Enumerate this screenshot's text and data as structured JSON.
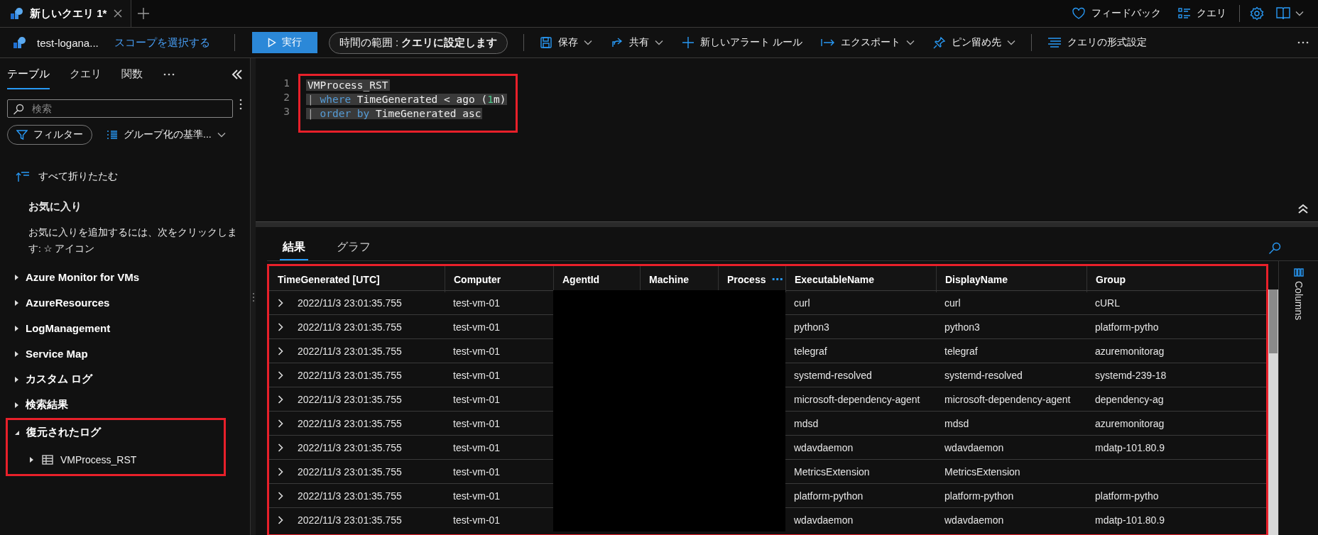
{
  "tabs": [
    {
      "label": "新しいクエリ 1*",
      "selected": true
    }
  ],
  "top_actions": [
    {
      "label": "フィードバック",
      "kind": "heart"
    },
    {
      "label": "クエリ",
      "kind": "list"
    }
  ],
  "toolbar": {
    "workspace": "test-logana...",
    "scope_link": "スコープを選択する",
    "run": "実行",
    "time_range": "時間の範囲 : **クエリに設定します**",
    "actions": [
      {
        "label": "保存",
        "kind": "save",
        "dropdown": true
      },
      {
        "label": "共有",
        "kind": "share",
        "dropdown": true
      },
      {
        "label": "新しいアラート ルール",
        "kind": "plus",
        "dropdown": false
      },
      {
        "label": "エクスポート",
        "kind": "export",
        "dropdown": true
      },
      {
        "label": "ピン留め先",
        "kind": "pin",
        "dropdown": true
      },
      {
        "label": "クエリの形式設定",
        "kind": "format",
        "dropdown": false
      }
    ]
  },
  "sidebar": {
    "tabs": [
      {
        "label": "テーブル",
        "selected": true
      },
      {
        "label": "クエリ",
        "selected": false
      },
      {
        "label": "関数",
        "selected": false
      }
    ],
    "search": {
      "placeholder": "検索"
    },
    "filter": "フィルター",
    "group_by": "グループ化の基準...",
    "collapse_all": "すべて折りたたむ",
    "favorites": {
      "title": "お気に入り",
      "hint": "お気に入りを追加するには、次をクリックします:  ☆ アイコン"
    },
    "tree": [
      {
        "label": "Azure Monitor for VMs",
        "expanded": false,
        "annotated": false
      },
      {
        "label": "AzureResources",
        "expanded": false,
        "annotated": false
      },
      {
        "label": "LogManagement",
        "expanded": false,
        "annotated": false
      },
      {
        "label": "Service Map",
        "expanded": false,
        "annotated": false
      },
      {
        "label": "カスタム ログ",
        "expanded": false,
        "annotated": false
      },
      {
        "label": "検索結果",
        "expanded": false,
        "annotated": false
      },
      {
        "label": "復元されたログ",
        "expanded": true,
        "annotated": true,
        "children": [
          {
            "label": "VMProcess_RST",
            "expanded": false
          }
        ]
      }
    ]
  },
  "editor": {
    "annotated": true,
    "lines": [
      {
        "number": "1",
        "selected": true,
        "tokens": [
          {
            "text": "VMProcess_RST",
            "kind": "plain"
          }
        ]
      },
      {
        "number": "2",
        "selected": true,
        "tokens": [
          {
            "text": "| ",
            "kind": "pipe"
          },
          {
            "text": "where",
            "kind": "keyword"
          },
          {
            "text": " TimeGenerated < ago (",
            "kind": "plain"
          },
          {
            "text": "1",
            "kind": "number"
          },
          {
            "text": "m)",
            "kind": "plain"
          }
        ]
      },
      {
        "number": "3",
        "selected": true,
        "tokens": [
          {
            "text": "| ",
            "kind": "pipe"
          },
          {
            "text": "order by",
            "kind": "keyword"
          },
          {
            "text": " TimeGenerated asc",
            "kind": "plain"
          }
        ]
      }
    ]
  },
  "results": {
    "tabs": [
      {
        "label": "結果",
        "selected": true
      },
      {
        "label": "グラフ",
        "selected": false
      }
    ],
    "annotated": true,
    "columns": [
      {
        "label": "TimeGenerated [UTC]"
      },
      {
        "label": "Computer"
      },
      {
        "label": "AgentId"
      },
      {
        "label": "Machine"
      },
      {
        "label": "Process",
        "icon": "⋯"
      },
      {
        "label": "ExecutableName"
      },
      {
        "label": "DisplayName"
      },
      {
        "label": "Group"
      }
    ],
    "rows": [
      {
        "cells": [
          "2022/11/3 23:01:35.755",
          "test-vm-01",
          null,
          null,
          null,
          "curl",
          "curl",
          "cURL"
        ]
      },
      {
        "cells": [
          "2022/11/3 23:01:35.755",
          "test-vm-01",
          null,
          null,
          null,
          "python3",
          "python3",
          "platform-pytho"
        ]
      },
      {
        "cells": [
          "2022/11/3 23:01:35.755",
          "test-vm-01",
          null,
          null,
          null,
          "telegraf",
          "telegraf",
          "azuremonitorag"
        ]
      },
      {
        "cells": [
          "2022/11/3 23:01:35.755",
          "test-vm-01",
          null,
          null,
          null,
          "systemd-resolved",
          "systemd-resolved",
          "systemd-239-18"
        ]
      },
      {
        "cells": [
          "2022/11/3 23:01:35.755",
          "test-vm-01",
          null,
          null,
          null,
          "microsoft-dependency-agent",
          "microsoft-dependency-agent",
          "dependency-ag"
        ]
      },
      {
        "cells": [
          "2022/11/3 23:01:35.755",
          "test-vm-01",
          null,
          null,
          null,
          "mdsd",
          "mdsd",
          "azuremonitorag"
        ]
      },
      {
        "cells": [
          "2022/11/3 23:01:35.755",
          "test-vm-01",
          null,
          null,
          null,
          "wdavdaemon",
          "wdavdaemon",
          "mdatp-101.80.9"
        ]
      },
      {
        "cells": [
          "2022/11/3 23:01:35.755",
          "test-vm-01",
          null,
          null,
          null,
          "MetricsExtension",
          "MetricsExtension"
        ]
      },
      {
        "cells": [
          "2022/11/3 23:01:35.755",
          "test-vm-01",
          null,
          null,
          null,
          "platform-python",
          "platform-python",
          "platform-pytho"
        ]
      },
      {
        "cells": [
          "2022/11/3 23:01:35.755",
          "test-vm-01",
          null,
          null,
          null,
          "wdavdaemon",
          "wdavdaemon",
          "mdatp-101.80.9"
        ]
      }
    ],
    "side_panel": "Columns"
  }
}
